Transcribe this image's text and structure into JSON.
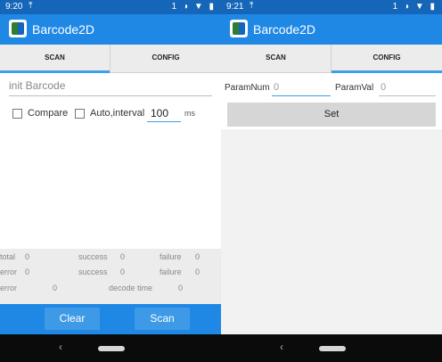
{
  "left": {
    "statusbar": {
      "time": "9:20",
      "upload_icon": "⤒",
      "right": "1 ◑ ▼ ▮"
    },
    "app_title": "Barcode2D",
    "tabs": [
      "SCAN",
      "CONFIG"
    ],
    "active_tab": 0,
    "init_placeholder": "init Barcode",
    "compare_label": "Compare",
    "auto_label": "Auto,interval",
    "interval_value": "100",
    "interval_unit": "ms",
    "stats": {
      "row1": {
        "total_label": "total",
        "total_val": "0",
        "success_label": "success",
        "success_val": "0",
        "failure_label": "failure",
        "failure_val": "0"
      },
      "row2": {
        "error_label": "error",
        "error_val": "0",
        "success_label": "success",
        "success_val": "0",
        "failure_label": "failure",
        "failure_val": "0"
      },
      "row3": {
        "error_label": "error",
        "error_val": "0",
        "decode_label": "decode time",
        "decode_val": "0"
      }
    },
    "buttons": {
      "clear": "Clear",
      "scan": "Scan"
    },
    "nav": {
      "back": "‹"
    }
  },
  "right": {
    "statusbar": {
      "time": "9:21",
      "upload_icon": "⤒",
      "right": "1 ◑ ▼ ▮"
    },
    "app_title": "Barcode2D",
    "tabs": [
      "SCAN",
      "CONFIG"
    ],
    "active_tab": 1,
    "param_num_label": "ParamNum",
    "param_num_value": "0",
    "param_val_label": "ParamVal",
    "param_val_value": "0",
    "set_label": "Set",
    "nav": {
      "back": "‹"
    }
  },
  "colors": {
    "appbar": "#1f88e5",
    "statusbar": "#1565b8",
    "tab_indicator": "#3ba0e8"
  }
}
